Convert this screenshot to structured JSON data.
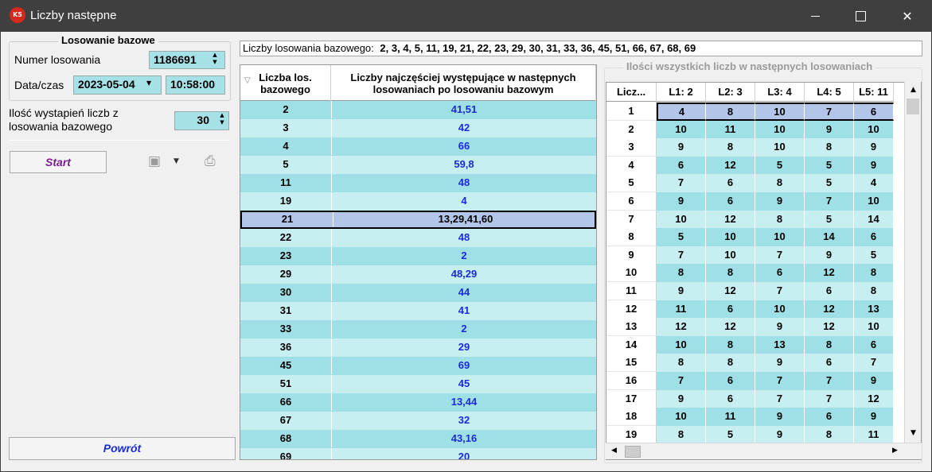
{
  "window": {
    "title": "Liczby następne",
    "app_icon_text": "K5"
  },
  "left": {
    "group_title": "Losowanie bazowe",
    "numer_label": "Numer losowania",
    "numer_value": "1186691",
    "data_label": "Data/czas",
    "date_value": "2023-05-04",
    "time_value": "10:58:00",
    "ilosc_label_1": "Ilość wystapień liczb z",
    "ilosc_label_2": "losowania bazowego",
    "ilosc_value": "30",
    "start_label": "Start",
    "powrot_label": "Powrót"
  },
  "info": {
    "label": "Liczby losowania bazowego:",
    "values": "2, 3, 4, 5, 11, 19, 21, 22, 23, 29, 30, 31, 33, 36, 45, 51, 66, 67, 68, 69"
  },
  "mid_grid": {
    "col1_header": "Liczba los. bazowego",
    "col2_header": "Liczby najczęściej występujące w następnych losowaniach po losowaniu bazowym",
    "rows": [
      {
        "n": "2",
        "v": "41,51"
      },
      {
        "n": "3",
        "v": "42"
      },
      {
        "n": "4",
        "v": "66"
      },
      {
        "n": "5",
        "v": "59,8"
      },
      {
        "n": "11",
        "v": "48"
      },
      {
        "n": "19",
        "v": "4"
      },
      {
        "n": "21",
        "v": "13,29,41,60"
      },
      {
        "n": "22",
        "v": "48"
      },
      {
        "n": "23",
        "v": "2"
      },
      {
        "n": "29",
        "v": "48,29"
      },
      {
        "n": "30",
        "v": "44"
      },
      {
        "n": "31",
        "v": "41"
      },
      {
        "n": "33",
        "v": "2"
      },
      {
        "n": "36",
        "v": "29"
      },
      {
        "n": "45",
        "v": "69"
      },
      {
        "n": "51",
        "v": "45"
      },
      {
        "n": "66",
        "v": "13,44"
      },
      {
        "n": "67",
        "v": "32"
      },
      {
        "n": "68",
        "v": "43,16"
      },
      {
        "n": "69",
        "v": "20"
      }
    ]
  },
  "right_grid": {
    "group_title": "Ilości wszystkich liczb w następnych losowaniach",
    "headers": [
      "Licz...",
      "L1: 2",
      "L2: 3",
      "L3: 4",
      "L4: 5",
      "L5: 11"
    ],
    "rows": [
      [
        "1",
        "4",
        "8",
        "10",
        "7",
        "6"
      ],
      [
        "2",
        "10",
        "11",
        "10",
        "9",
        "10"
      ],
      [
        "3",
        "9",
        "8",
        "10",
        "8",
        "9"
      ],
      [
        "4",
        "6",
        "12",
        "5",
        "5",
        "9"
      ],
      [
        "5",
        "7",
        "6",
        "8",
        "5",
        "4"
      ],
      [
        "6",
        "9",
        "6",
        "9",
        "7",
        "10"
      ],
      [
        "7",
        "10",
        "12",
        "8",
        "5",
        "14"
      ],
      [
        "8",
        "5",
        "10",
        "10",
        "14",
        "6"
      ],
      [
        "9",
        "7",
        "10",
        "7",
        "9",
        "5"
      ],
      [
        "10",
        "8",
        "8",
        "6",
        "12",
        "8"
      ],
      [
        "11",
        "9",
        "12",
        "7",
        "6",
        "8"
      ],
      [
        "12",
        "11",
        "6",
        "10",
        "12",
        "13"
      ],
      [
        "13",
        "12",
        "12",
        "9",
        "12",
        "10"
      ],
      [
        "14",
        "10",
        "8",
        "13",
        "8",
        "6"
      ],
      [
        "15",
        "8",
        "8",
        "9",
        "6",
        "7"
      ],
      [
        "16",
        "7",
        "6",
        "7",
        "7",
        "9"
      ],
      [
        "17",
        "9",
        "6",
        "7",
        "7",
        "12"
      ],
      [
        "18",
        "10",
        "11",
        "9",
        "6",
        "9"
      ],
      [
        "19",
        "8",
        "5",
        "9",
        "8",
        "11"
      ]
    ]
  }
}
